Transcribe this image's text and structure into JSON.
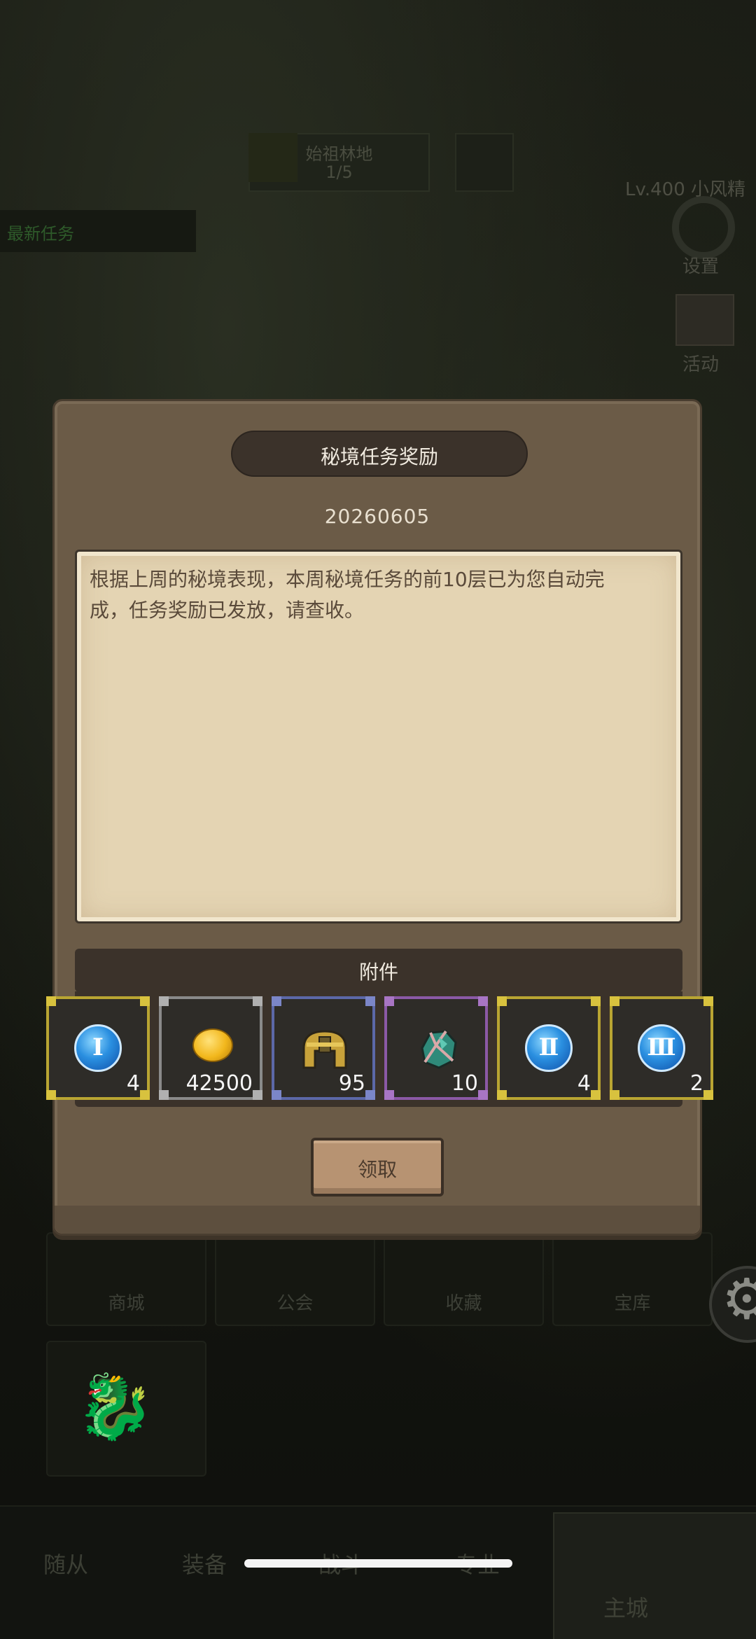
{
  "background": {
    "top_panel_title": "始祖林地",
    "top_panel_progress": "1/5",
    "level_text": "Lv.400 小风精",
    "left_tag": "最新任务",
    "labels": [
      "设置",
      "活动"
    ],
    "tiles": [
      "商城",
      "公会",
      "收藏",
      "宝库"
    ],
    "nav": [
      "随从",
      "装备",
      "战斗",
      "专业",
      "主城"
    ]
  },
  "modal": {
    "title": "秘境任务奖励",
    "date": "20260605",
    "message": "根据上周的秘境表现，本周秘境任务的前10层已为您自动完成，任务奖励已发放，请查收。",
    "attachments_label": "附件",
    "items": [
      {
        "name": "rune-orb-1",
        "glyph": "Ⅰ",
        "count": "4",
        "quality": "gold",
        "icon": "blue-orb-icon"
      },
      {
        "name": "gold-coin",
        "glyph": "",
        "count": "42500",
        "quality": "gray",
        "icon": "gold-coin-icon"
      },
      {
        "name": "helmet",
        "glyph": "",
        "count": "95",
        "quality": "blue",
        "icon": "helmet-icon"
      },
      {
        "name": "ore",
        "glyph": "",
        "count": "10",
        "quality": "purple",
        "icon": "ore-icon"
      },
      {
        "name": "rune-orb-2",
        "glyph": "Ⅱ",
        "count": "4",
        "quality": "gold",
        "icon": "blue-orb-icon"
      },
      {
        "name": "rune-orb-3",
        "glyph": "Ⅲ",
        "count": "2",
        "quality": "gold",
        "icon": "blue-orb-icon"
      }
    ],
    "claim_label": "领取"
  }
}
